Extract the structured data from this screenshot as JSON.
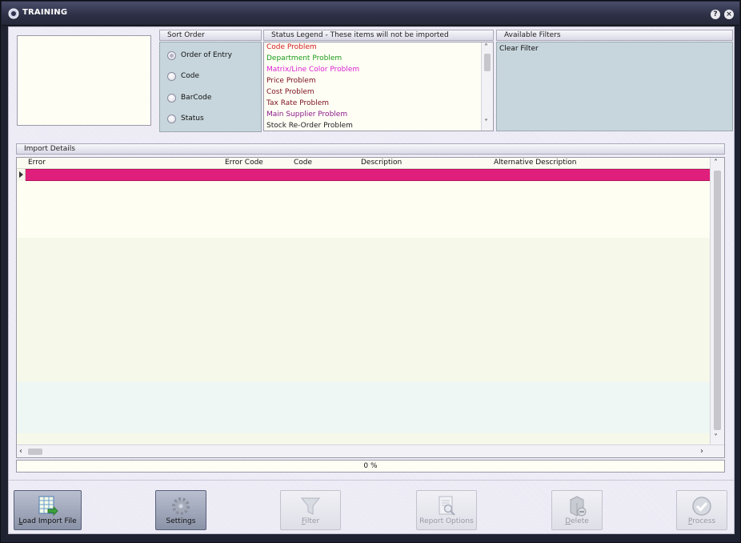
{
  "window": {
    "title": "TRAINING",
    "help_button": "?",
    "close_button": "×"
  },
  "sort_order": {
    "header": "Sort Order",
    "options": [
      "Order of Entry",
      "Code",
      "BarCode",
      "Status"
    ],
    "selected": "Order of Entry"
  },
  "status_legend": {
    "header": "Status Legend - These items will not be imported",
    "items": [
      {
        "label": "Code Problem",
        "color": "#d01c1c"
      },
      {
        "label": "Department Problem",
        "color": "#1b9a1b"
      },
      {
        "label": "Matrix/Line Color Problem",
        "color": "#d81fd0"
      },
      {
        "label": "Price Problem",
        "color": "#7a0f1c"
      },
      {
        "label": "Cost Problem",
        "color": "#7a0f1c"
      },
      {
        "label": "Tax Rate Problem",
        "color": "#7a0f1c"
      },
      {
        "label": "Main Supplier Problem",
        "color": "#8a1a8a"
      },
      {
        "label": "Stock Re-Order Problem",
        "color": "#222222"
      }
    ]
  },
  "available_filters": {
    "header": "Available Filters",
    "items": [
      "Clear Filter"
    ]
  },
  "import_details": {
    "header": "Import Details",
    "columns": [
      "Error",
      "Error Code",
      "Code",
      "Description",
      "Alternative Description"
    ],
    "selected_row_color": "#e01f7c"
  },
  "progress": {
    "text": "0 %",
    "value": 0
  },
  "buttons": [
    {
      "label": "Load Import File",
      "mnemonic": "L",
      "icon": "spreadsheet-import-icon",
      "enabled": true
    },
    {
      "label": "Settings",
      "icon": "gear-icon",
      "enabled": true
    },
    {
      "label": "Filter",
      "mnemonic": "F",
      "icon": "funnel-icon",
      "enabled": false
    },
    {
      "label": "Report Options",
      "icon": "report-magnifier-icon",
      "enabled": false
    },
    {
      "label": "Delete",
      "mnemonic": "D",
      "icon": "delete-bin-icon",
      "enabled": false
    },
    {
      "label": "Process",
      "mnemonic": "P",
      "icon": "checkmark-icon",
      "enabled": false
    }
  ]
}
